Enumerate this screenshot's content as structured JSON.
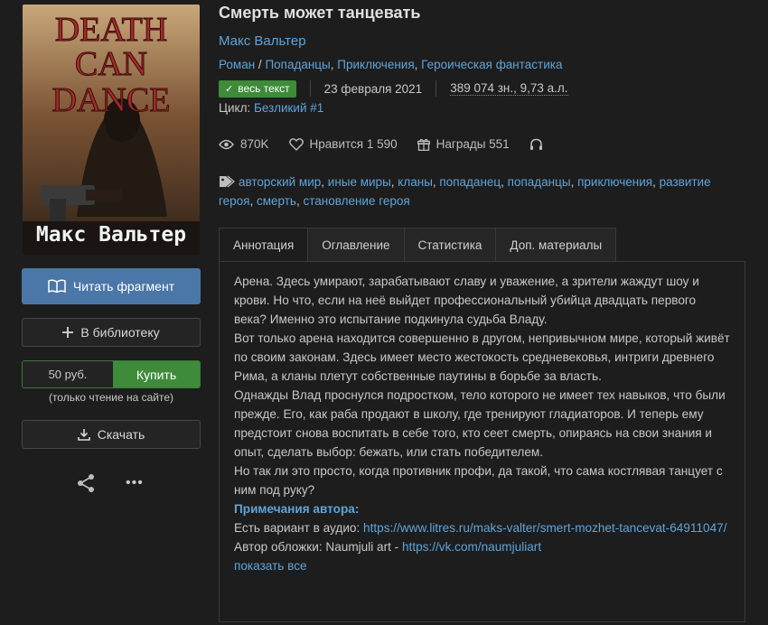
{
  "book": {
    "title": "Смерть может танцевать",
    "author": "Макс Вальтер",
    "genres": [
      "Роман",
      "Попаданцы",
      "Приключения",
      "Героическая фантастика"
    ],
    "genre_sep_first": " / ",
    "genre_sep": ", ",
    "badge": "весь текст",
    "date": "23 февраля 2021",
    "size": "389 074 зн., 9,73 а.л.",
    "cycle_label": "Цикл:",
    "cycle_value": "Безликий #1"
  },
  "cover": {
    "line1": "DEATH",
    "line2": "CAN",
    "line3": "DANCE",
    "author_sig": "Макс Вальтер"
  },
  "left": {
    "read_label": "Читать фрагмент",
    "library_label": "В библиотеку",
    "price": "50 руб.",
    "buy_label": "Купить",
    "buy_note": "(только чтение на сайте)",
    "download_label": "Скачать"
  },
  "stats": {
    "views": "870K",
    "likes_label": "Нравится 1 590",
    "awards_label": "Награды 551"
  },
  "tags": [
    "авторский мир",
    "иные миры",
    "кланы",
    "попаданец",
    "попаданцы",
    "приключения",
    "развитие героя",
    "смерть",
    "становление героя"
  ],
  "tabs": [
    "Аннотация",
    "Оглавление",
    "Статистика",
    "Доп. материалы"
  ],
  "annotation": [
    "Арена. Здесь умирают, зарабатывают славу и уважение, а зрители жаждут шоу и крови. Но что, если на неё выйдет профессиональный убийца двадцать первого века? Именно это испытание подкинула судьба Владу.",
    "Вот только арена находится совершенно в другом, непривычном мире, который живёт по своим законам. Здесь имеет место жестокость средневековья, интриги древнего Рима, а кланы плетут собственные паутины в борьбе за власть.",
    "Однажды Влад проснулся подростком, тело которого не имеет тех навыков, что были прежде. Его, как раба продают в школу, где тренируют гладиаторов. И теперь ему предстоит снова воспитать в себе того, кто сеет смерть, опираясь на свои знания и опыт, сделать выбор: бежать, или стать победителем.",
    "Но так ли это просто, когда противник профи, да такой, что сама костлявая танцует с ним под руку?"
  ],
  "notes": {
    "heading": "Примечания автора:",
    "audio_label": "Есть вариант в аудио: ",
    "audio_link": "https://www.litres.ru/maks-valter/smert-mozhet-tancevat-64911047/",
    "cover_label": "Автор обложки: Naumjuli art - ",
    "cover_link": "https://vk.com/naumjuliart",
    "show_all": "показать все"
  },
  "colors": {
    "background": "#1d1d1d",
    "link": "#5fa4d9",
    "primary_button": "#4a77a8",
    "buy_green": "#3e8b3a"
  },
  "icons": [
    "book-open-icon",
    "plus-icon",
    "download-icon",
    "share-icon",
    "more-icon",
    "eye-icon",
    "heart-icon",
    "gift-icon",
    "headphones-icon",
    "tag-icon",
    "check-icon"
  ]
}
